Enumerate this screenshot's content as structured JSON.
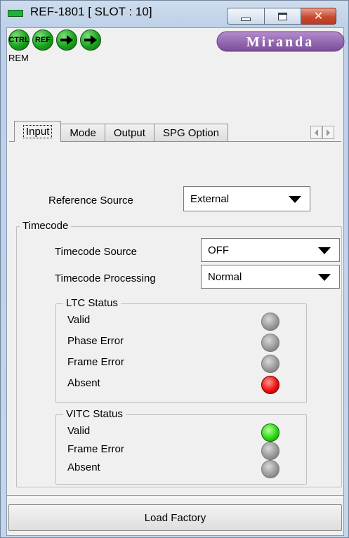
{
  "window": {
    "title": "REF-1801 [ SLOT : 10]",
    "close_glyph": "✕"
  },
  "status_icons": [
    {
      "label": "CTRL",
      "icon": "ctrl-status-icon"
    },
    {
      "label": "REF",
      "icon": "ref-status-icon"
    },
    {
      "label": "",
      "icon": "arrow-right-icon"
    },
    {
      "label": "",
      "icon": "arrow-right-icon"
    }
  ],
  "rem_label": "REM",
  "brand": "Miranda",
  "tabs": [
    {
      "label": "Input",
      "active": true
    },
    {
      "label": "Mode",
      "active": false
    },
    {
      "label": "Output",
      "active": false
    },
    {
      "label": "SPG Option",
      "active": false
    }
  ],
  "input": {
    "reference_source_label": "Reference Source",
    "reference_source_value": "External",
    "timecode_group_label": "Timecode",
    "timecode_source_label": "Timecode Source",
    "timecode_source_value": "OFF",
    "timecode_processing_label": "Timecode Processing",
    "timecode_processing_value": "Normal",
    "ltc": {
      "title": "LTC Status",
      "rows": [
        {
          "label": "Valid",
          "status": "gray"
        },
        {
          "label": "Phase Error",
          "status": "gray"
        },
        {
          "label": "Frame Error",
          "status": "gray"
        },
        {
          "label": "Absent",
          "status": "red"
        }
      ]
    },
    "vitc": {
      "title": "VITC Status",
      "rows": [
        {
          "label": "Valid",
          "status": "green"
        },
        {
          "label": "Frame Error",
          "status": "gray"
        },
        {
          "label": "Absent",
          "status": "gray"
        }
      ]
    }
  },
  "load_factory_label": "Load Factory",
  "colors": {
    "led_gray": "#9a9a9a",
    "led_red": "#ee1010",
    "led_green": "#2bd814",
    "brand_purple": "#8a5aa8"
  }
}
